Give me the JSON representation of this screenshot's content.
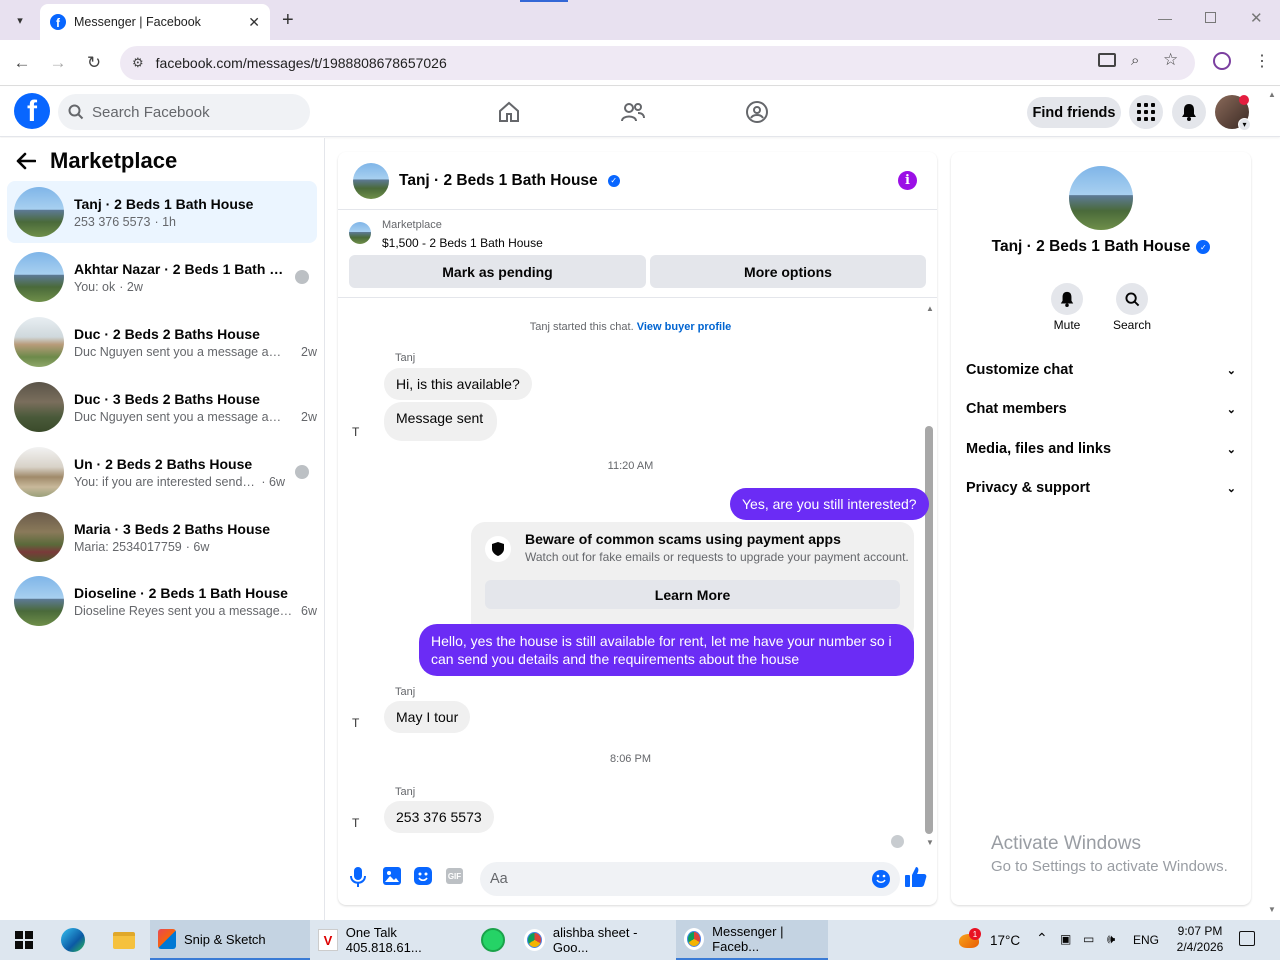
{
  "browser": {
    "tab_title": "Messenger | Facebook",
    "url": "facebook.com/messages/t/1988808678657026"
  },
  "fb": {
    "search_placeholder": "Search Facebook",
    "find_friends": "Find friends"
  },
  "sidebar": {
    "title": "Marketplace",
    "conversations": [
      {
        "name": "Tanj · 2 Beds 1 Bath House",
        "snippet": "253 376 5573",
        "time": "· 1h",
        "active": true
      },
      {
        "name": "Akhtar Nazar · 2 Beds 1 Bath Ho...",
        "snippet": "You: ok",
        "time": "· 2w"
      },
      {
        "name": "Duc · 2 Beds 2 Baths House",
        "snippet": "Duc Nguyen sent you a message abo...",
        "time": "2w"
      },
      {
        "name": "Duc · 3 Beds 2 Baths House",
        "snippet": "Duc Nguyen sent you a message abo...",
        "time": "2w"
      },
      {
        "name": "Un · 2 Beds 2 Baths House",
        "snippet": "You: if you are interested send you...",
        "time": "· 6w"
      },
      {
        "name": "Maria · 3 Beds 2 Baths House",
        "snippet": "Maria: 2534017759",
        "time": "· 6w"
      },
      {
        "name": "Dioseline · 2 Beds 1 Bath House",
        "snippet": "Dioseline Reyes sent you a message a...",
        "time": "6w"
      }
    ]
  },
  "chat": {
    "header_name": "Tanj · 2 Beds 1 Bath House",
    "listing_label": "Marketplace",
    "listing_title": "$1,500 - 2 Beds 1 Bath House",
    "mark_pending": "Mark as pending",
    "more_options": "More options",
    "started_text": "Tanj started this chat.",
    "view_profile": "View buyer profile",
    "sender": "Tanj",
    "broken_img": "T",
    "msg1": "Hi, is this available?",
    "msg2": "Message sent",
    "time1": "11:20 AM",
    "msg3": "Yes, are you still interested?",
    "scam_title": "Beware of common scams using payment apps",
    "scam_body": "Watch out for fake emails or requests to upgrade your payment account.",
    "learn_more": "Learn More",
    "msg4": "Hello, yes the house is still available for rent, let me have your number so i can send you details and the requirements about the house",
    "msg5": "May I tour",
    "time2": "8:06 PM",
    "msg6": "253 376 5573",
    "input_placeholder": "Aa"
  },
  "right": {
    "name": "Tanj · 2 Beds 1 Bath House",
    "mute": "Mute",
    "search": "Search",
    "sections": [
      "Customize chat",
      "Chat members",
      "Media, files and links",
      "Privacy & support"
    ]
  },
  "watermark": {
    "line1": "Activate Windows",
    "line2": "Go to Settings to activate Windows."
  },
  "taskbar": {
    "snip": "Snip & Sketch",
    "onetalk": "One Talk 405.818.61...",
    "sheet": "alishba sheet - Goo...",
    "messenger": "Messenger | Faceb...",
    "temp": "17°C",
    "lang": "ENG",
    "time": "9:07 PM",
    "date": "2/4/2026",
    "weather_badge": "1"
  },
  "colors": {
    "fb_blue": "#0866ff",
    "outgoing_bubble": "#6b2cf5",
    "active_conv": "#ebf5ff"
  }
}
